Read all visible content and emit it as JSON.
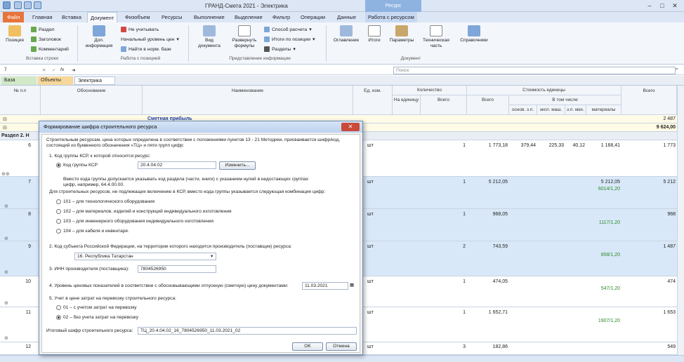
{
  "window": {
    "title": "ГРАНД-Смета 2021 - Электрика",
    "context_group": "Ресурс",
    "minimize": "–",
    "maximize": "□",
    "close": "✕"
  },
  "tabs": [
    "Файл",
    "Главная",
    "Вставка",
    "Документ",
    "Физобъем",
    "Ресурсы",
    "Выполнение",
    "Выделение",
    "Фильтр",
    "Операции",
    "Данные",
    "Работа с ресурсом"
  ],
  "ribbon": {
    "position": "Позиция",
    "section": "Раздел",
    "header": "Заголовок",
    "comment": "Комментарий",
    "group_insert": "Вставка строки",
    "add_info": "Доп. информация",
    "not_count": "Не учитывать",
    "start_level": "Начальный уровень цен",
    "find_norm": "Найти в норм. базе",
    "group_positions": "Работа с позицией",
    "view_doc": "Вид документа",
    "expand_formulas": "Развернуть формулы",
    "calc_method": "Способ расчета",
    "totals_by_pos": "Итоги по позиции",
    "sections": "Разделы",
    "group_view": "Представление информации",
    "toc": "Оглавление",
    "totals": "Итоги",
    "params": "Параметры",
    "tech_part": "Техническая часть",
    "refs": "Справочники",
    "group_doc": "Документ"
  },
  "formula": {
    "cell": "7",
    "fx": "fx",
    "value": "➜",
    "search_placeholder": "Поиск"
  },
  "file_tabs": [
    "База",
    "Объекты",
    "Электрика"
  ],
  "columns": {
    "num": "№ п.п",
    "basis": "Обоснование",
    "name": "Наименование",
    "unit": "Ед. изм.",
    "qty": "Количество",
    "per_unit": "На единицу",
    "qty_total": "Всего",
    "unit_cost": "Стоимость единицы",
    "cost_total": "Всего",
    "including": "В том числе",
    "base_wage": "основ. з.п.",
    "mach": "эксп. маш.",
    "mach_wage": "з.п. мех.",
    "materials": "материалы",
    "grand_total": "Всего"
  },
  "rows": {
    "profit": {
      "label": "Сметная прибыль",
      "total": "2 487"
    },
    "summary": {
      "total": "9 624,00"
    },
    "section": {
      "label": "Раздел 2. Н"
    },
    "items": [
      {
        "num": "6",
        "unit": "шт",
        "qty": "1",
        "cost": "1 773,18",
        "base": "379,44",
        "mach": "225,33",
        "machw": "40,12",
        "mat": "1 168,41",
        "mat2": "",
        "total": "1 773"
      },
      {
        "num": "7",
        "unit": "шт",
        "qty": "1",
        "cost": "5 212,05",
        "base": "",
        "mach": "",
        "machw": "",
        "mat": "5 212,05",
        "mat2": "6014/1,20",
        "total": "5 212"
      },
      {
        "num": "8",
        "unit": "шт",
        "qty": "1",
        "cost": "968,05",
        "base": "",
        "mach": "",
        "machw": "",
        "mat": "",
        "mat2": "1117/1,20",
        "total": "968"
      },
      {
        "num": "9",
        "unit": "шт",
        "qty": "2",
        "cost": "743,59",
        "base": "",
        "mach": "",
        "machw": "",
        "mat": "",
        "mat2": "858/1,20",
        "total": "1 487"
      },
      {
        "num": "10",
        "unit": "шт",
        "qty": "1",
        "cost": "474,05",
        "base": "",
        "mach": "",
        "machw": "",
        "mat": "",
        "mat2": "547/1,20",
        "total": "474"
      },
      {
        "num": "11",
        "unit": "шт",
        "qty": "1",
        "cost": "1 652,71",
        "base": "",
        "mach": "",
        "machw": "",
        "mat": "",
        "mat2": "1907/1,20",
        "total": "1 653"
      },
      {
        "num": "12",
        "unit": "шт",
        "qty": "3",
        "cost": "182,86",
        "base": "",
        "mach": "",
        "machw": "",
        "mat": "",
        "mat2": "",
        "total": "549"
      }
    ]
  },
  "dialog": {
    "title": "Формирование шифра строительного ресурса",
    "close": "✕",
    "intro": "Строительным ресурсам, цена которых определена в соответствии с положениями пунктов 13 - 21 Методики, присваивается шифр/код,",
    "intro2": "состоящий из буквенного обозначения «ТЦ» и пяти групп цифр:",
    "s1": "1. Код группы КСР, к которой относится ресурс:",
    "ksr_label": "Код группы КСР",
    "ksr_value": "20.4.04.02",
    "change_btn": "Изменить...",
    "note1": "Вместо кода группы допускается указывать код раздела (части, книги) с указанием нулей в недостающих группах",
    "note2": "цифр, например, 64.4.00.00.",
    "note3": "Для строительных ресурсов, не подлежащих включению в КСР, вместо кода группы указывается следующая комбинация цифр:",
    "opt101": "101 – для технологического оборудования",
    "opt102": "102 – для материалов, изделий и конструкций индивидуального изготовления",
    "opt103": "103 – для инженерного оборудования индивидуального изготовления",
    "opt104": "104 – для кабеля и инвентаря.",
    "s2": "2. Код субъекта Российской Федерации, на территории которого находится производитель (поставщик) ресурса:",
    "region": "16. Республика Татарстан",
    "s3": "3. ИНН производителя (поставщика):",
    "inn": "7804526950",
    "s4": "4. Уровень ценовых показателей в соответствии с обосновывающими отпускную (сметную) цену документами:",
    "date": "11.03.2021",
    "s5": "5. Учет в цене затрат на перевозку строительного ресурса:",
    "opt01": "01 – с учетом затрат на перевозку",
    "opt02": "02 – без учета затрат на перевозку",
    "result_label": "Итоговый шифр строительного ресурса:",
    "result": "ТЦ_20.4.04.02_16_7804526950_11.03.2021_02",
    "ok": "OK",
    "cancel": "Отмена"
  },
  "colors": {
    "accent": "#e8743b",
    "ribbon": "#dce6f4",
    "row_blue": "#d9e8f8",
    "green": "#2a8a2a"
  }
}
